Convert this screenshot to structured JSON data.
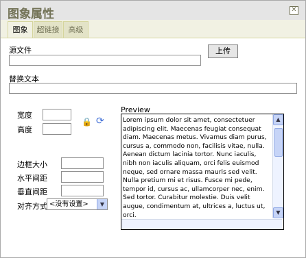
{
  "dialog": {
    "title": "图象属性"
  },
  "tabs": [
    {
      "label": "图象"
    },
    {
      "label": "超链接"
    },
    {
      "label": "高级"
    }
  ],
  "form": {
    "src_label": "源文件",
    "upload_label": "上传",
    "alt_label": "替换文本",
    "width_label": "宽度",
    "height_label": "高度",
    "border_label": "边框大小",
    "hspace_label": "水平间距",
    "vspace_label": "垂直间距",
    "align_label": "对齐方式",
    "align_value": "<没有设置>",
    "preview_label": "Preview",
    "preview_text": "Lorem ipsum dolor sit amet, consectetuer adipiscing elit. Maecenas feugiat consequat diam. Maecenas metus. Vivamus diam purus, cursus a, commodo non, facilisis vitae, nulla. Aenean dictum lacinia tortor. Nunc iaculis, nibh non iaculis aliquam, orci felis euismod neque, sed ornare massa mauris sed velit. Nulla pretium mi et risus. Fusce mi pede, tempor id, cursus ac, ullamcorper nec, enim. Sed tortor. Curabitur molestie. Duis velit augue, condimentum at, ultrices a, luctus ut, orci."
  },
  "icons": {
    "lock": "lock-icon",
    "reset": "refresh-icon",
    "close": "close-icon"
  }
}
